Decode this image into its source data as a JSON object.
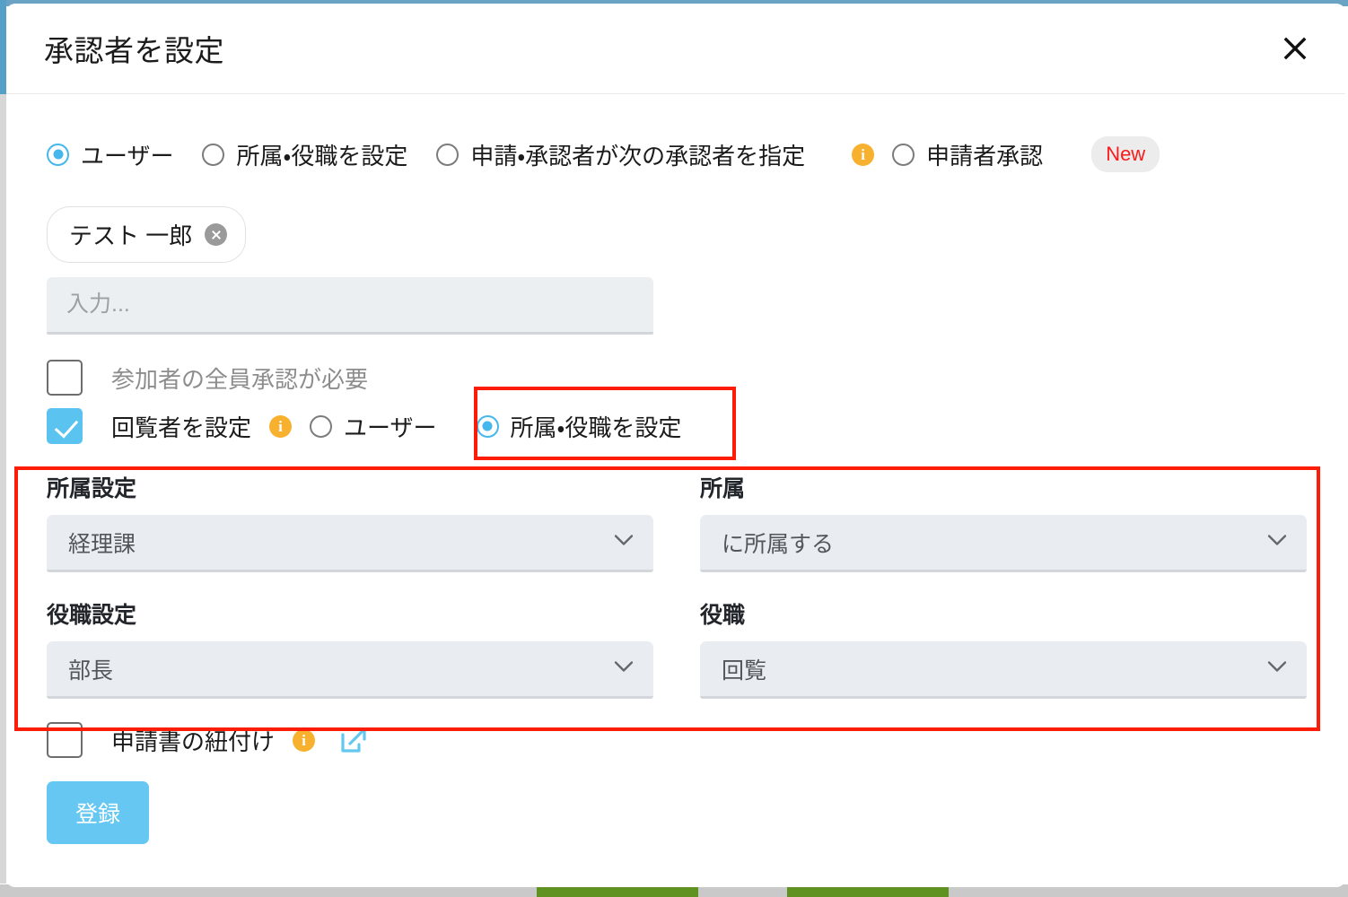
{
  "dialog": {
    "title": "承認者を設定",
    "close_icon": "close-icon"
  },
  "approver_type": {
    "options": [
      {
        "label": "ユーザー",
        "selected": true
      },
      {
        "label": "所属・役職を設定",
        "selected": false
      },
      {
        "label": "申請・承認者が次の承認者を指定",
        "selected": false
      },
      {
        "label": "申請者承認",
        "selected": false
      }
    ],
    "info_icon": "info-icon",
    "new_badge": "New"
  },
  "user_select": {
    "chip": {
      "name": "テスト 一郎",
      "remove_icon": "close-circle-icon"
    },
    "input_placeholder": "入力...",
    "input_value": ""
  },
  "options": {
    "all_approve": {
      "label": "参加者の全員承認が必要",
      "checked": false
    },
    "circulator": {
      "label": "回覧者を設定",
      "checked": true,
      "info_icon": "info-icon",
      "radios": [
        {
          "label": "ユーザー",
          "selected": false
        },
        {
          "label": "所属・役職を設定",
          "selected": true
        }
      ]
    }
  },
  "fields": {
    "affiliation_setting": {
      "label": "所属設定",
      "value": "経理課"
    },
    "affiliation": {
      "label": "所属",
      "value": "に所属する"
    },
    "position_setting": {
      "label": "役職設定",
      "value": "部長"
    },
    "position": {
      "label": "役職",
      "value": "回覧"
    }
  },
  "link_application": {
    "label": "申請書の紐付け",
    "checked": false,
    "info_icon": "info-icon",
    "external_icon": "external-link-icon"
  },
  "submit": {
    "label": "登録"
  },
  "colors": {
    "accent_blue": "#46b7ec",
    "submit_blue": "#66c8f2",
    "info_orange": "#f7b12e",
    "highlight_red": "#fd1c06",
    "new_badge_text": "#fc1a1a",
    "top_band": "#6aa3c4",
    "field_bg": "#e9edf1",
    "bg_toolbar_green": "#5f9220"
  }
}
